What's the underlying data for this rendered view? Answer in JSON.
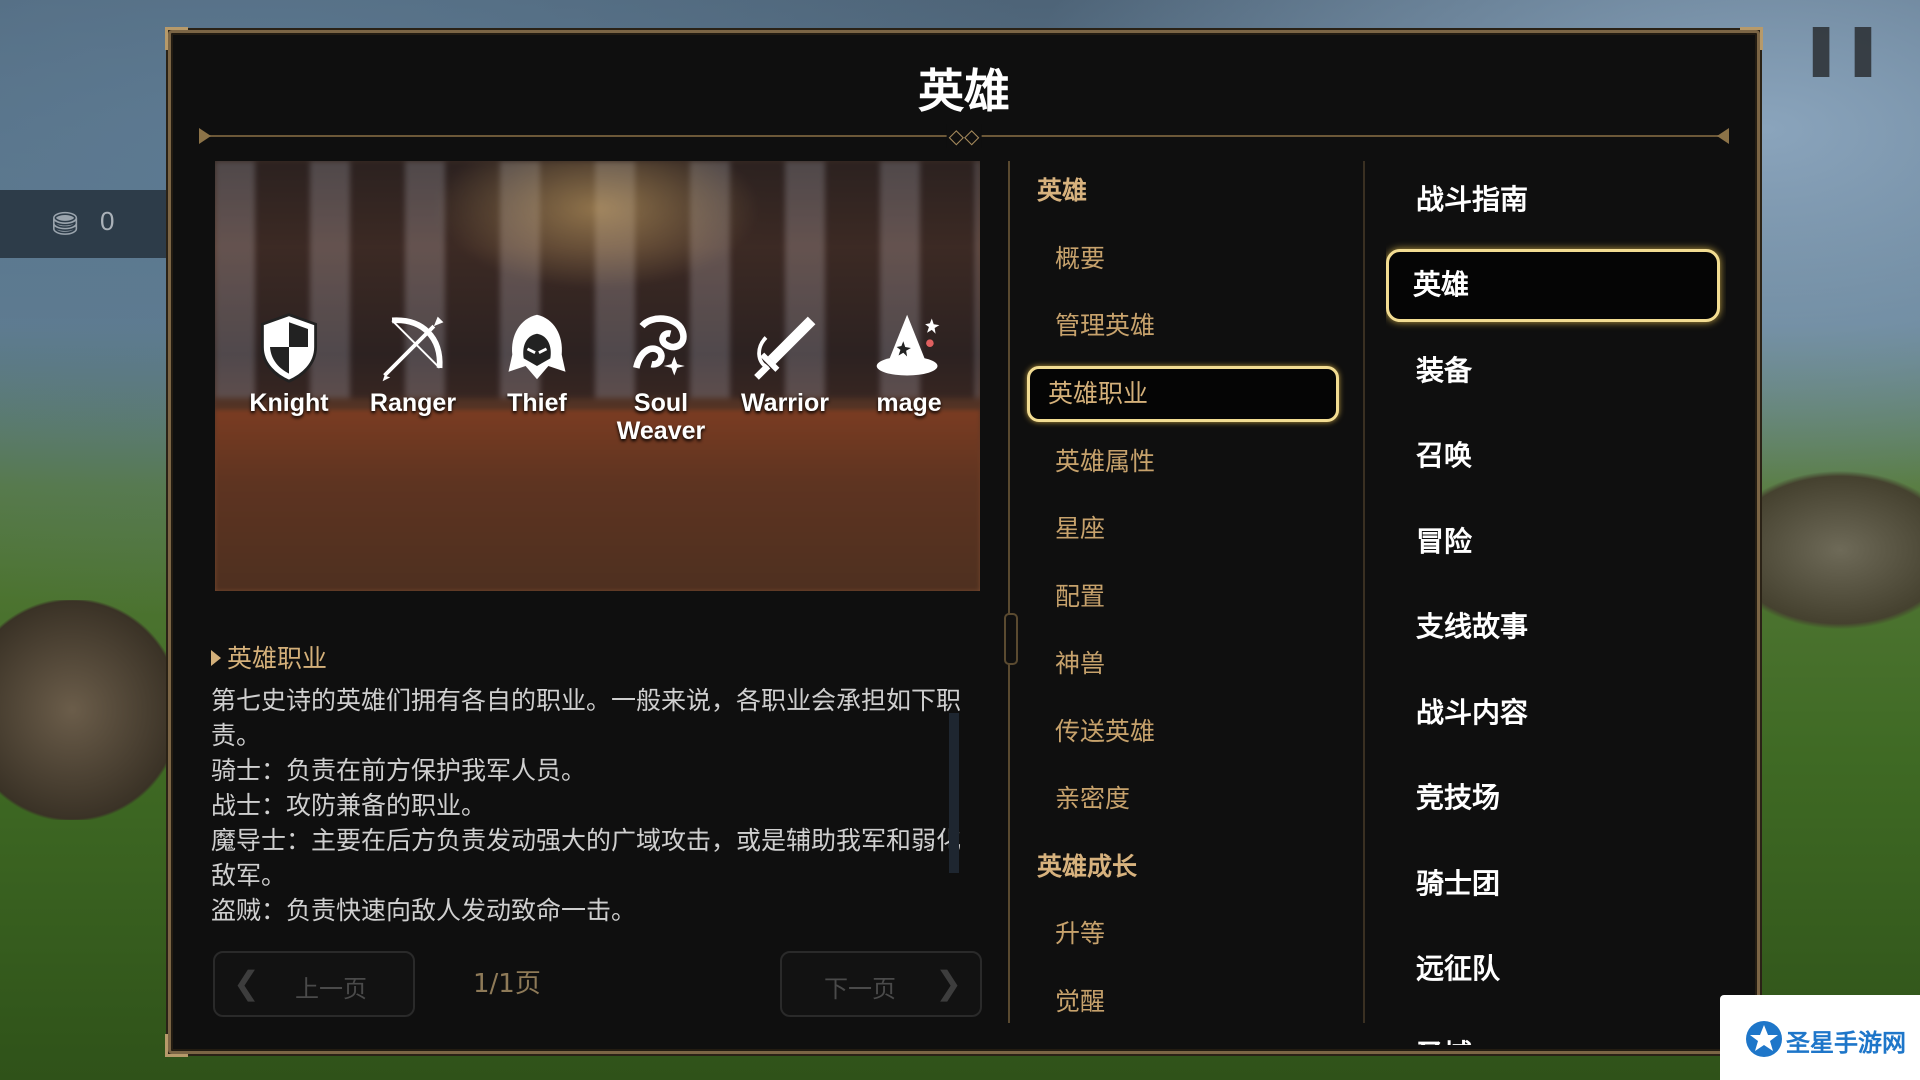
{
  "hud": {
    "icon": "treasure-chest-icon",
    "count": "0"
  },
  "top_right_icons": [
    "chat-icon",
    "pause-icon"
  ],
  "panel": {
    "title": "英雄"
  },
  "hero_classes": [
    {
      "name": "Knight",
      "icon": "shield-icon"
    },
    {
      "name": "Ranger",
      "icon": "bow-icon"
    },
    {
      "name": "Thief",
      "icon": "hood-icon"
    },
    {
      "name": "Soul\nWeaver",
      "icon": "soul-weaver-icon"
    },
    {
      "name": "Warrior",
      "icon": "sword-icon"
    },
    {
      "name": "mage",
      "icon": "wizard-hat-icon"
    }
  ],
  "content": {
    "section_title": "英雄职业",
    "paragraphs": [
      "第七史诗的英雄们拥有各自的职业。一般来说，各职业会承担如下职责。",
      "骑士：负责在前方保护我军人员。",
      "战士：攻防兼备的职业。",
      "魔导士：主要在后方负责发动强大的广域攻击，或是辅助我军和弱化敌军。",
      "盗贼：负责快速向敌人发动致命一击。"
    ]
  },
  "pager": {
    "prev_label": "上一页",
    "next_label": "下一页",
    "page_indicator": "1/1页"
  },
  "sub_menu": [
    {
      "label": "英雄",
      "type": "category"
    },
    {
      "label": "概要",
      "type": "child"
    },
    {
      "label": "管理英雄",
      "type": "child"
    },
    {
      "label": "英雄职业",
      "type": "child",
      "active": true
    },
    {
      "label": "英雄属性",
      "type": "child"
    },
    {
      "label": "星座",
      "type": "child"
    },
    {
      "label": "配置",
      "type": "child"
    },
    {
      "label": "神兽",
      "type": "child"
    },
    {
      "label": "传送英雄",
      "type": "child"
    },
    {
      "label": "亲密度",
      "type": "child"
    },
    {
      "label": "英雄成长",
      "type": "category"
    },
    {
      "label": "升等",
      "type": "child"
    },
    {
      "label": "觉醒",
      "type": "child"
    }
  ],
  "main_menu": [
    {
      "label": "战斗指南"
    },
    {
      "label": "英雄",
      "active": true
    },
    {
      "label": "装备"
    },
    {
      "label": "召唤"
    },
    {
      "label": "冒险"
    },
    {
      "label": "支线故事"
    },
    {
      "label": "战斗内容"
    },
    {
      "label": "竞技场"
    },
    {
      "label": "骑士团"
    },
    {
      "label": "远征队"
    },
    {
      "label": "圣域"
    }
  ],
  "watermark": {
    "text": "圣星手游网"
  }
}
